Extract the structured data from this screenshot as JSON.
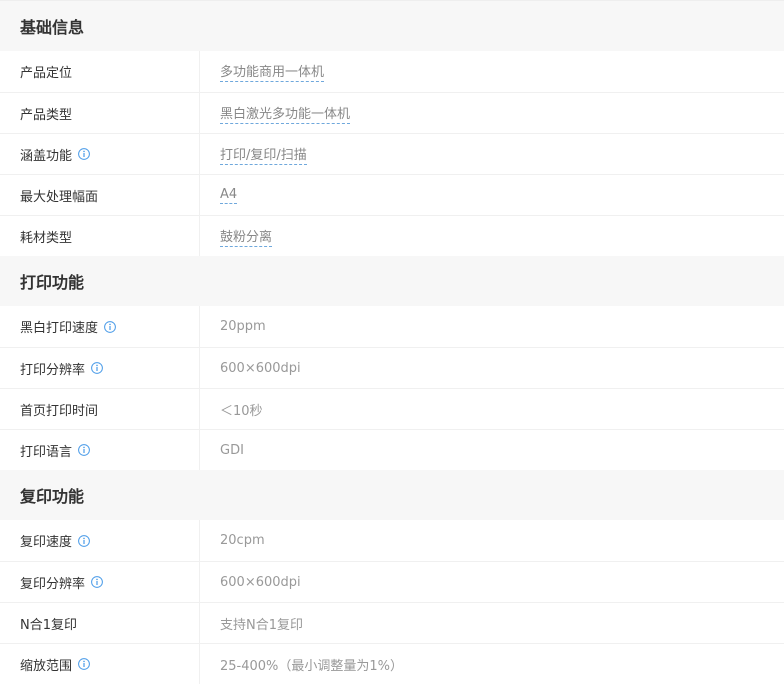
{
  "sections": [
    {
      "title": "基础信息",
      "rows": [
        {
          "label": "产品定位",
          "value": "多功能商用一体机",
          "info": false,
          "link": true
        },
        {
          "label": "产品类型",
          "value": "黑白激光多功能一体机",
          "info": false,
          "link": true
        },
        {
          "label": "涵盖功能",
          "value": "打印/复印/扫描",
          "info": true,
          "link": true
        },
        {
          "label": "最大处理幅面",
          "value": "A4",
          "info": false,
          "link": true
        },
        {
          "label": "耗材类型",
          "value": "鼓粉分离",
          "info": false,
          "link": true
        }
      ]
    },
    {
      "title": "打印功能",
      "rows": [
        {
          "label": "黑白打印速度",
          "value": "20ppm",
          "info": true,
          "link": false
        },
        {
          "label": "打印分辨率",
          "value": "600×600dpi",
          "info": true,
          "link": false
        },
        {
          "label": "首页打印时间",
          "value": "＜10秒",
          "info": false,
          "link": false
        },
        {
          "label": "打印语言",
          "value": "GDI",
          "info": true,
          "link": false
        }
      ]
    },
    {
      "title": "复印功能",
      "rows": [
        {
          "label": "复印速度",
          "value": "20cpm",
          "info": true,
          "link": false
        },
        {
          "label": "复印分辨率",
          "value": "600×600dpi",
          "info": true,
          "link": false
        },
        {
          "label": "N合1复印",
          "value": "支持N合1复印",
          "info": false,
          "link": false
        },
        {
          "label": "缩放范围",
          "value": "25-400%（最小调整量为1%）",
          "info": true,
          "link": false
        }
      ]
    }
  ],
  "colors": {
    "section_bg": "#f7f7f7",
    "info_icon": "#4a9be8",
    "link_underline": "#6fa8dc",
    "value_text": "#999999"
  },
  "icons": {
    "info": "info-circle-icon"
  }
}
